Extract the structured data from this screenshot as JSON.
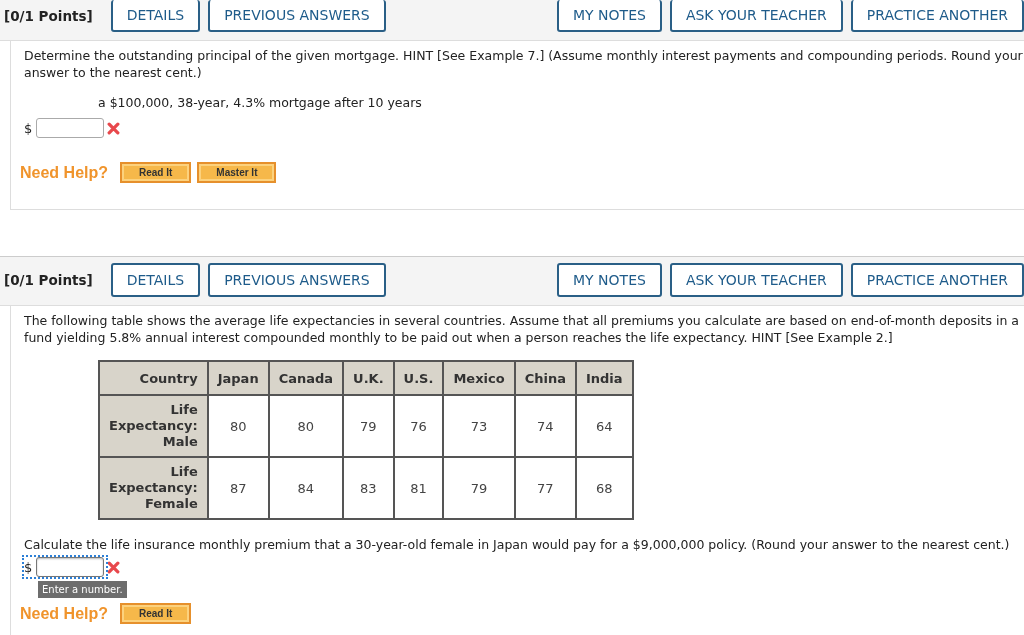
{
  "questions": [
    {
      "points": "[0/1 Points]",
      "buttons": [
        {
          "label": "DETAILS"
        },
        {
          "label": "PREVIOUS ANSWERS"
        },
        {
          "label": "MY NOTES"
        },
        {
          "label": "ASK YOUR TEACHER"
        },
        {
          "label": "PRACTICE ANOTHER"
        }
      ],
      "prompt": "Determine the outstanding principal of the given mortgage. HINT [See Example 7.] (Assume monthly interest payments and compounding periods. Round your answer to the nearest cent.)",
      "subprompt": "a $100,000, 38-year, 4.3% mortgage after 10 years",
      "answer": {
        "prefix": "$",
        "incorrect": true,
        "focused": false
      },
      "help": {
        "label": "Need Help?",
        "buttons": [
          "Read It",
          "Master It"
        ]
      }
    },
    {
      "points": "[0/1 Points]",
      "buttons": [
        {
          "label": "DETAILS"
        },
        {
          "label": "PREVIOUS ANSWERS"
        },
        {
          "label": "MY NOTES"
        },
        {
          "label": "ASK YOUR TEACHER"
        },
        {
          "label": "PRACTICE ANOTHER"
        }
      ],
      "prompt": "The following table shows the average life expectancies in several countries. Assume that all premiums you calculate are based on end-of-month deposits in a fund yielding 5.8% annual interest compounded monthly to be paid out when a person reaches the life expectancy. HINT [See Example 2.]",
      "table": {
        "columns": [
          "Country",
          "Japan",
          "Canada",
          "U.K.",
          "U.S.",
          "Mexico",
          "China",
          "India"
        ],
        "rows": [
          [
            "Life Expectancy: Male",
            "80",
            "80",
            "79",
            "76",
            "73",
            "74",
            "64"
          ],
          [
            "Life Expectancy: Female",
            "87",
            "84",
            "83",
            "81",
            "79",
            "77",
            "68"
          ]
        ]
      },
      "question": "Calculate the life insurance monthly premium that a 30-year-old female in Japan would pay for a $9,000,000 policy. (Round your answer to the nearest cent.)",
      "answer": {
        "prefix": "$",
        "incorrect": true,
        "focused": true,
        "tooltip": "Enter a number."
      },
      "help": {
        "label": "Need Help?",
        "buttons": [
          "Read It"
        ]
      }
    }
  ]
}
